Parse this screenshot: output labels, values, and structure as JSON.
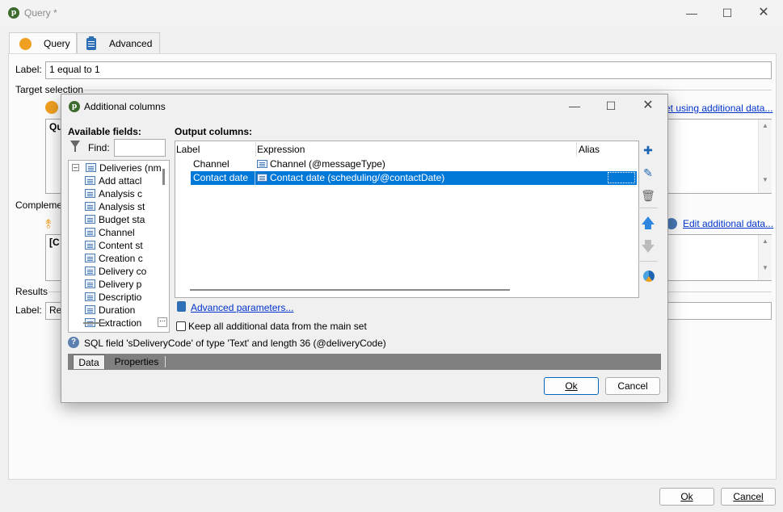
{
  "window": {
    "title": "Query *",
    "tabs": [
      {
        "label": "Query"
      },
      {
        "label": "Advanced"
      }
    ],
    "label_field": {
      "label": "Label:",
      "value": "1 equal to 1"
    },
    "target_selection": {
      "title": "Target selection",
      "link": "et using additional data...",
      "text": "Qu"
    },
    "complement": {
      "title": "Compleme",
      "link": "Edit additional data...",
      "text": "[C"
    },
    "results": {
      "title": "Results",
      "label": "Label:",
      "value": "Res"
    },
    "ok_label": "Ok",
    "cancel_label": "Cancel"
  },
  "dialog": {
    "title": "Additional columns",
    "available_fields": {
      "title": "Available fields:",
      "find_label": "Find:",
      "find_value": "",
      "root": "Deliveries (nm",
      "items": [
        {
          "label": "Add attacl"
        },
        {
          "label": "Analysis c"
        },
        {
          "label": "Analysis st"
        },
        {
          "label": "Budget sta"
        },
        {
          "label": "Channel"
        },
        {
          "label": "Content st"
        },
        {
          "label": "Creation c"
        },
        {
          "label": "Delivery co"
        },
        {
          "label": "Delivery p"
        },
        {
          "label": "Descriptio"
        },
        {
          "label": "Duration"
        },
        {
          "label": "Extraction"
        }
      ]
    },
    "output_columns": {
      "title": "Output columns:",
      "headers": {
        "label": "Label",
        "expression": "Expression",
        "alias": "Alias"
      },
      "rows": [
        {
          "label": "Channel",
          "expression": "Channel (@messageType)",
          "alias": "",
          "selected": false
        },
        {
          "label": "Contact date",
          "expression": "Contact date (scheduling/@contactDate)",
          "alias": "",
          "selected": true
        }
      ]
    },
    "advanced_link": "Advanced parameters...",
    "keep_checkbox": {
      "label": "Keep all additional data from the main set",
      "checked": false
    },
    "info_text": "SQL field 'sDeliveryCode' of type 'Text' and length 36 (@deliveryCode)",
    "bottom_tabs": [
      {
        "label": "Data"
      },
      {
        "label": "Properties"
      }
    ],
    "ok_label": "Ok",
    "cancel_label": "Cancel"
  },
  "colors": {
    "selection": "#0078d7",
    "link": "#0033cc",
    "accent_orange": "#f0a020",
    "status_bar": "#808080"
  }
}
